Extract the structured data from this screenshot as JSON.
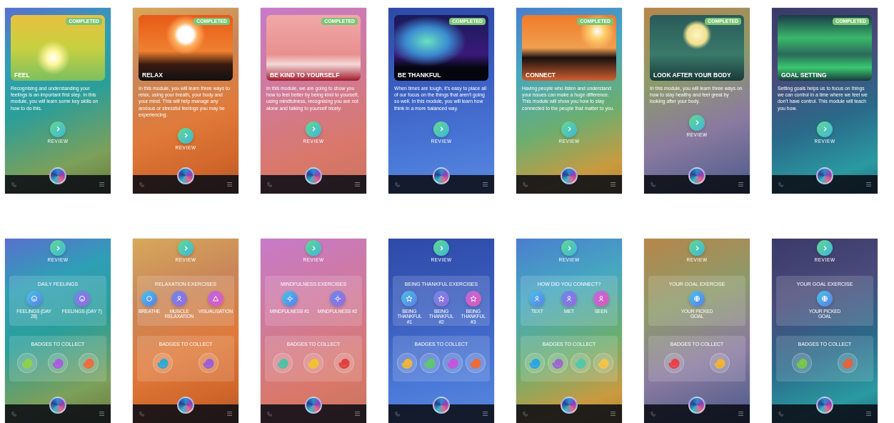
{
  "modules": [
    {
      "title": "FEEL",
      "badge": "COMPLETED",
      "description": "Recognising and understanding your feelings is an important first step. In this module, you will learn some key skills on how to do this.",
      "review": "REVIEW"
    },
    {
      "title": "RELAX",
      "badge": "COMPLETED",
      "description": "In this module, you will learn three ways to relax, using your breath, your body and your mind. This will help manage any anxious or stressful feelings you may be experiencing.",
      "review": "REVIEW"
    },
    {
      "title": "BE KIND TO YOURSELF",
      "badge": "COMPLETED",
      "description": "In this module, we are going to show you how to feel better by being kind to yourself, using mindfulness, recognising you are not alone and talking to yourself nicely.",
      "review": "REVIEW"
    },
    {
      "title": "BE THANKFUL",
      "badge": "COMPLETED",
      "description": "When times are tough, it's easy to place all of our focus on the things that aren't going so well. In this module, you will learn how think in a more balanced way.",
      "review": "REVIEW"
    },
    {
      "title": "CONNECT",
      "badge": "COMPLETED",
      "description": "Having people who listen and understand your issues can make a huge difference. This module will show you how to stay connected to the people that matter to you.",
      "review": "REVIEW"
    },
    {
      "title": "LOOK AFTER YOUR BODY",
      "badge": "COMPLETED",
      "description": "In this module, you will learn three ways on how to stay healthy and feel great by looking after your body.",
      "review": "REVIEW"
    },
    {
      "title": "GOAL SETTING",
      "badge": "COMPLETED",
      "description": "Setting goals helps us to focus on things we can control in a time where we feel we don't have control. This module will teach you how.",
      "review": "REVIEW"
    }
  ],
  "details": [
    {
      "review": "REVIEW",
      "exercise_title": "DAILY FEELINGS",
      "exercises": [
        {
          "label": "FEELINGS (DAY 28)"
        },
        {
          "label": "FEELINGS (DAY 7)"
        }
      ],
      "badges_title": "BADGES TO COLLECT",
      "badges": [
        {
          "color": "#8fd14f"
        },
        {
          "color": "#a65ee0"
        },
        {
          "color": "#f06a3a"
        }
      ]
    },
    {
      "review": "REVIEW",
      "exercise_title": "RELAXATION EXERCISES",
      "exercises": [
        {
          "label": "BREATHE"
        },
        {
          "label": "MUSCLE RELAXATION"
        },
        {
          "label": "VISUALISATION"
        }
      ],
      "badges_title": "BADGES TO COLLECT",
      "badges": [
        {
          "color": "#2fa8d8"
        },
        {
          "color": "#9b5fd8"
        }
      ]
    },
    {
      "review": "REVIEW",
      "exercise_title": "MINDFULNESS EXERCISES",
      "exercises": [
        {
          "label": "MINDFULNESS #1"
        },
        {
          "label": "MINDFULNESS #2"
        }
      ],
      "badges_title": "BADGES TO COLLECT",
      "badges": [
        {
          "color": "#4fc1a8"
        },
        {
          "color": "#f2c230"
        },
        {
          "color": "#e0413f"
        }
      ]
    },
    {
      "review": "REVIEW",
      "exercise_title": "BEING THANKFUL EXERCISES",
      "exercises": [
        {
          "label": "BEING THANKFUL #1"
        },
        {
          "label": "BEING THANKFUL #2"
        },
        {
          "label": "BEING THANKFUL #3"
        }
      ],
      "badges_title": "BADGES TO COLLECT",
      "badges": [
        {
          "color": "#f0b53a"
        },
        {
          "color": "#5fc86a"
        },
        {
          "color": "#c653d8"
        },
        {
          "color": "#f06a32"
        }
      ]
    },
    {
      "review": "REVIEW",
      "exercise_title": "HOW DID YOU CONNECT?",
      "exercises": [
        {
          "label": "TEXT"
        },
        {
          "label": "MET"
        },
        {
          "label": "SEEN"
        }
      ],
      "badges_title": "BADGES TO COLLECT",
      "badges": [
        {
          "color": "#2aa6e0"
        },
        {
          "color": "#9a6ad0"
        },
        {
          "color": "#4fc9a8"
        },
        {
          "color": "#f2c64a"
        }
      ]
    },
    {
      "review": "REVIEW",
      "exercise_title": "YOUR GOAL EXERCISE",
      "exercises": [
        {
          "label": "YOUR PICKED GOAL"
        }
      ],
      "badges_title": "BADGES TO COLLECT",
      "badges": [
        {
          "color": "#e8404a"
        },
        {
          "color": "#f0b53a"
        }
      ]
    },
    {
      "review": "REVIEW",
      "exercise_title": "YOUR GOAL EXERCISE",
      "exercises": [
        {
          "label": "YOUR PICKED GOAL"
        }
      ],
      "badges_title": "BADGES TO COLLECT",
      "badges": [
        {
          "color": "#7cc84a"
        },
        {
          "color": "#e8623a"
        }
      ]
    }
  ]
}
